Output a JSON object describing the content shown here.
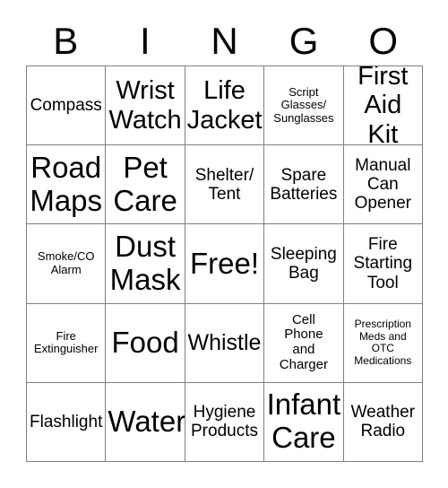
{
  "card": {
    "columns": [
      "B",
      "I",
      "N",
      "G",
      "O"
    ],
    "free_space_label": "Free!",
    "grid_line_color": "#808080",
    "background_color": "#ffffff",
    "text_color": "#000000",
    "rows": 5,
    "cols": 5,
    "cells": [
      {
        "text": "Compass",
        "size": "md"
      },
      {
        "text": "Wrist\nWatch",
        "size": "xl"
      },
      {
        "text": "Life\nJacket",
        "size": "xl"
      },
      {
        "text": "Script\nGlasses/\nSunglasses",
        "size": "xs"
      },
      {
        "text": "First\nAid Kit",
        "size": "xl"
      },
      {
        "text": "Road\nMaps",
        "size": "xxl"
      },
      {
        "text": "Pet\nCare",
        "size": "xxl"
      },
      {
        "text": "Shelter/\nTent",
        "size": "md"
      },
      {
        "text": "Spare\nBatteries",
        "size": "md"
      },
      {
        "text": "Manual\nCan\nOpener",
        "size": "md"
      },
      {
        "text": "Smoke/CO\nAlarm",
        "size": "xs"
      },
      {
        "text": "Dust\nMask",
        "size": "xxl"
      },
      {
        "text": "Free!",
        "size": "xxl"
      },
      {
        "text": "Sleeping\nBag",
        "size": "md"
      },
      {
        "text": "Fire\nStarting\nTool",
        "size": "md"
      },
      {
        "text": "Fire\nExtinguisher",
        "size": "xs"
      },
      {
        "text": "Food",
        "size": "xxl"
      },
      {
        "text": "Whistle",
        "size": "lg"
      },
      {
        "text": "Cell\nPhone\nand\nCharger",
        "size": "sm"
      },
      {
        "text": "Prescription\nMeds and\nOTC\nMedications",
        "size": "xxs"
      },
      {
        "text": "Flashlight",
        "size": "md"
      },
      {
        "text": "Water",
        "size": "xxl"
      },
      {
        "text": "Hygiene\nProducts",
        "size": "md"
      },
      {
        "text": "Infant\nCare",
        "size": "xxl"
      },
      {
        "text": "Weather\nRadio",
        "size": "md"
      }
    ]
  }
}
